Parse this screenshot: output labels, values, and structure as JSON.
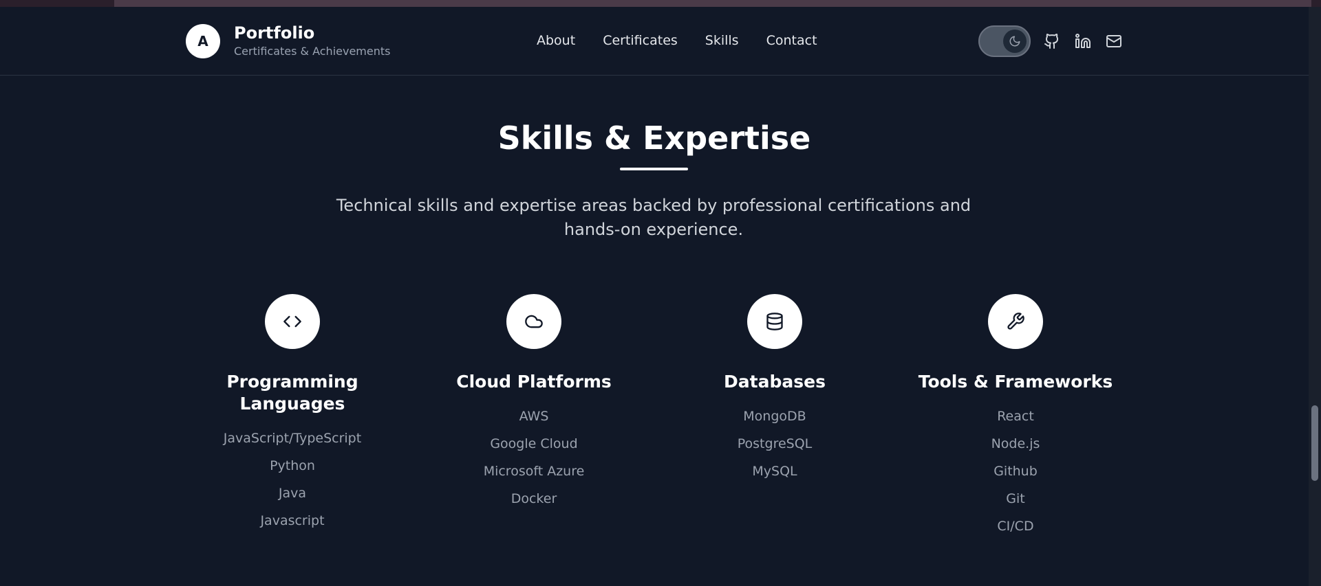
{
  "brand": {
    "initial": "A",
    "title": "Portfolio",
    "subtitle": "Certificates & Achievements"
  },
  "nav": {
    "items": [
      "About",
      "Certificates",
      "Skills",
      "Contact"
    ]
  },
  "header_icons": [
    "moon-icon",
    "github-icon",
    "linkedin-icon",
    "mail-icon"
  ],
  "skills_section": {
    "title": "Skills & Expertise",
    "description": "Technical skills and expertise areas backed by professional certifications and hands-on experience.",
    "categories": [
      {
        "icon": "code-icon",
        "heading": "Programming Languages",
        "items": [
          "JavaScript/TypeScript",
          "Python",
          "Java",
          "Javascript"
        ]
      },
      {
        "icon": "cloud-icon",
        "heading": "Cloud Platforms",
        "items": [
          "AWS",
          "Google Cloud",
          "Microsoft Azure",
          "Docker"
        ]
      },
      {
        "icon": "database-icon",
        "heading": "Databases",
        "items": [
          "MongoDB",
          "PostgreSQL",
          "MySQL"
        ]
      },
      {
        "icon": "wrench-icon",
        "heading": "Tools & Frameworks",
        "items": [
          "React",
          "Node.js",
          "Github",
          "Git",
          "CI/CD"
        ]
      }
    ]
  },
  "colors": {
    "background": "#111827",
    "text_primary": "#ffffff",
    "text_muted": "#9ca3af"
  }
}
